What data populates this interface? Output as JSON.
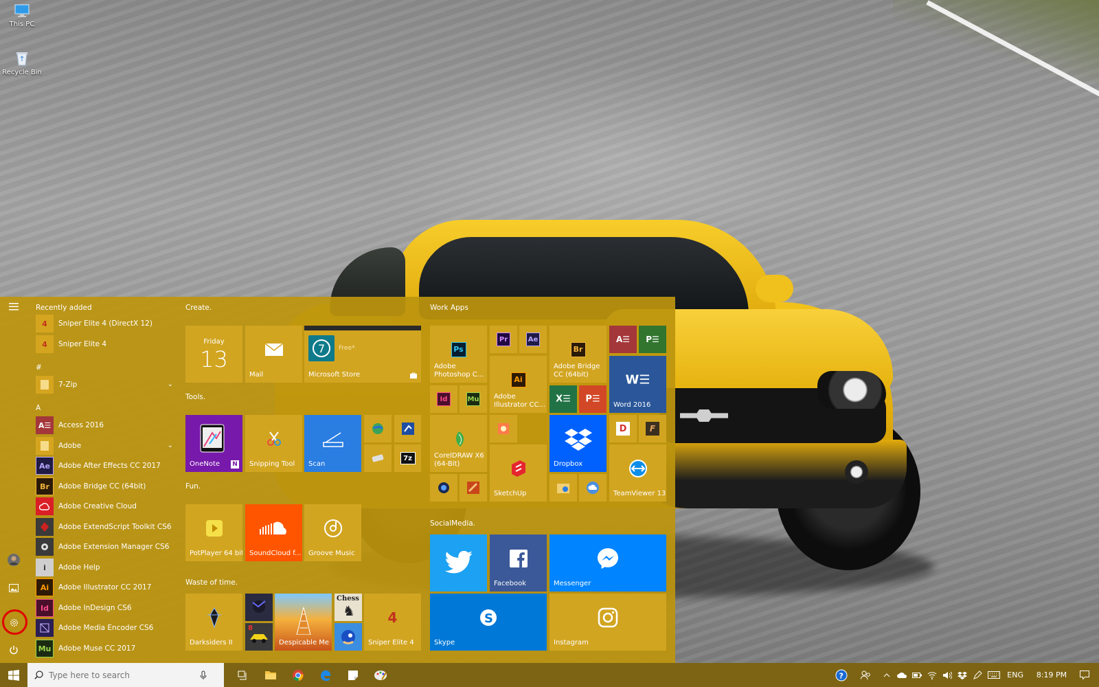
{
  "desktop": {
    "icons": [
      {
        "label": "This PC"
      },
      {
        "label": "Recycle Bin"
      }
    ]
  },
  "start_menu": {
    "recently_added_header": "Recently added",
    "recent_apps": [
      {
        "label": "Sniper Elite 4 (DirectX 12)",
        "icon": "4",
        "color": "#d6a51f"
      },
      {
        "label": "Sniper Elite 4",
        "icon": "4",
        "color": "#d6a51f"
      }
    ],
    "groups": [
      {
        "letter": "#",
        "apps": [
          {
            "label": "7-Zip",
            "icon": "",
            "color": "#d6a51f",
            "folder": true
          }
        ]
      },
      {
        "letter": "A",
        "apps": [
          {
            "label": "Access 2016",
            "icon": "A",
            "color": "#a4373a"
          },
          {
            "label": "Adobe",
            "icon": "",
            "color": "#d6a51f",
            "folder": true
          },
          {
            "label": "Adobe After Effects CC 2017",
            "icon": "Ae",
            "color": "#1f1b45"
          },
          {
            "label": "Adobe Bridge CC (64bit)",
            "icon": "Br",
            "color": "#2b1a08"
          },
          {
            "label": "Adobe Creative Cloud",
            "icon": "",
            "color": "#da1f26"
          },
          {
            "label": "Adobe ExtendScript Toolkit CS6",
            "icon": "",
            "color": "#3a3a3a"
          },
          {
            "label": "Adobe Extension Manager CS6",
            "icon": "",
            "color": "#3a3a3a"
          },
          {
            "label": "Adobe Help",
            "icon": "i",
            "color": "#cfcfcf"
          },
          {
            "label": "Adobe Illustrator CC 2017",
            "icon": "Ai",
            "color": "#2d1a06"
          },
          {
            "label": "Adobe InDesign CS6",
            "icon": "Id",
            "color": "#4a0f2a"
          },
          {
            "label": "Adobe Media Encoder CS6",
            "icon": "",
            "color": "#2a1f55"
          },
          {
            "label": "Adobe Muse CC 2017",
            "icon": "Mu",
            "color": "#1b2b12"
          }
        ]
      }
    ],
    "rail": {
      "menu_icon": "hamburger-icon",
      "user_icon": "avatar",
      "pictures_icon": "pictures-icon",
      "settings_icon": "gear-icon",
      "power_icon": "power-icon"
    },
    "sections": {
      "create": "Create.",
      "tools": "Tools.",
      "fun": "Fun.",
      "waste": "Waste of time.",
      "work": "Work Apps",
      "social": "SocialMedia."
    },
    "tiles": {
      "calendar_day": "Friday",
      "calendar_date": "13",
      "mail": "Mail",
      "store": "Microsoft Store",
      "store_free": "Free*",
      "onenote": "OneNote",
      "snipping": "Snipping Tool",
      "scan": "Scan",
      "potplayer": "PotPlayer 64 bit",
      "soundcloud": "SoundCloud f...",
      "groove": "Groove Music",
      "darksiders": "Darksiders II",
      "despicable": "Despicable Me",
      "sniper": "Sniper Elite 4",
      "chess": "Chess",
      "photoshop": "Adobe Photoshop C...",
      "illustrator": "Adobe Illustrator CC...",
      "bridge": "Adobe Bridge CC (64bit)",
      "word": "Word 2016",
      "coreldraw": "CorelDRAW X6 (64-Bit)",
      "sketchup": "SketchUp",
      "dropbox": "Dropbox",
      "teamviewer": "TeamViewer 13",
      "twitter": "",
      "facebook": "Facebook",
      "messenger": "Messenger",
      "skype": "Skype",
      "instagram": "Instagram",
      "pr": "Pr",
      "ae": "Ae",
      "id": "Id",
      "mu": "Mu",
      "ai": "Ai",
      "ps": "Ps",
      "br": "Br",
      "x": "X",
      "p": "P",
      "d": "D",
      "f": "F",
      "sevenz": "7z"
    }
  },
  "taskbar": {
    "search_placeholder": "Type here to search",
    "language": "ENG",
    "time": "8:19 PM"
  },
  "colors": {
    "accent": "#bc940e",
    "tile": "#d2a521",
    "taskbar": "#7d6414",
    "scan": "#2a7de1",
    "twitter": "#1da1f2",
    "facebook": "#3b5998",
    "messenger": "#0084ff",
    "skype": "#0078d7",
    "soundcloud": "#ff5500",
    "dropbox": "#0061fe",
    "word": "#2b579a",
    "onenote": "#7719aa"
  }
}
